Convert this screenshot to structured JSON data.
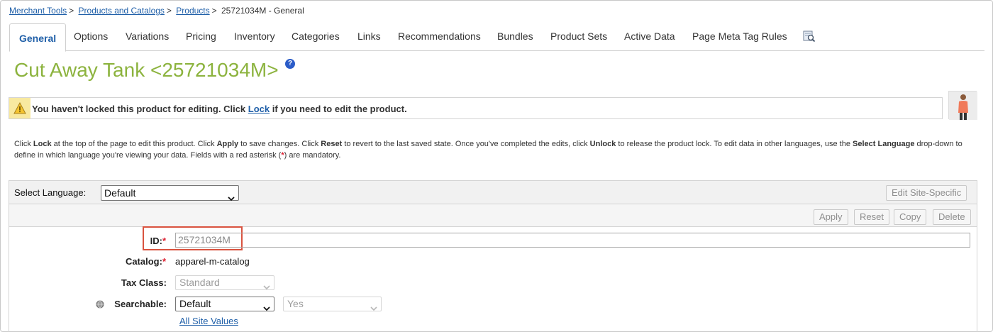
{
  "breadcrumb": {
    "items": [
      "Merchant Tools",
      "Products and Catalogs",
      "Products"
    ],
    "current": "25721034M - General",
    "separator": ">"
  },
  "tabs": [
    {
      "label": "General",
      "active": true
    },
    {
      "label": "Options"
    },
    {
      "label": "Variations"
    },
    {
      "label": "Pricing"
    },
    {
      "label": "Inventory"
    },
    {
      "label": "Categories"
    },
    {
      "label": "Links"
    },
    {
      "label": "Recommendations"
    },
    {
      "label": "Bundles"
    },
    {
      "label": "Product Sets"
    },
    {
      "label": "Active Data"
    },
    {
      "label": "Page Meta Tag Rules"
    }
  ],
  "tab_icon": "preview-search-icon",
  "title": "Cut Away Tank <25721034M>",
  "help_icon": "?",
  "warning": {
    "text_before": "You haven't locked this product for editing. Click ",
    "link": "Lock",
    "text_after": " if you need to edit the product."
  },
  "instructions": {
    "p1": "Click ",
    "b1": "Lock",
    "p2": " at the top of the page to edit this product. Click ",
    "b2": "Apply",
    "p3": " to save changes. Click ",
    "b3": "Reset",
    "p4": " to revert to the last saved state. Once you've completed the edits, click ",
    "b4": "Unlock",
    "p5": " to release the product lock. To edit data in other languages, use the ",
    "b5": "Select Language",
    "p6": " drop-down to define in which language you're viewing your data. Fields with a red asterisk (",
    "asterisk": "*",
    "p7": ") are mandatory."
  },
  "toolbar": {
    "language_label": "Select Language:",
    "language_value": "Default",
    "edit_site_specific": "Edit Site-Specific"
  },
  "actions": {
    "apply": "Apply",
    "reset": "Reset",
    "copy": "Copy",
    "delete": "Delete"
  },
  "form": {
    "id_label": "ID:",
    "id_value": "25721034M",
    "catalog_label": "Catalog:",
    "catalog_value": "apparel-m-catalog",
    "tax_class_label": "Tax Class:",
    "tax_class_value": "Standard",
    "searchable_label": "Searchable:",
    "searchable_value": "Default",
    "searchable_secondary": "Yes",
    "all_site_values": "All Site Values",
    "required_mark": "*"
  },
  "colors": {
    "title": "#8cb33e",
    "link": "#1f5fa8",
    "highlight": "#d9533f",
    "warning_bg": "#f8e9a0",
    "required": "#dd2233"
  }
}
